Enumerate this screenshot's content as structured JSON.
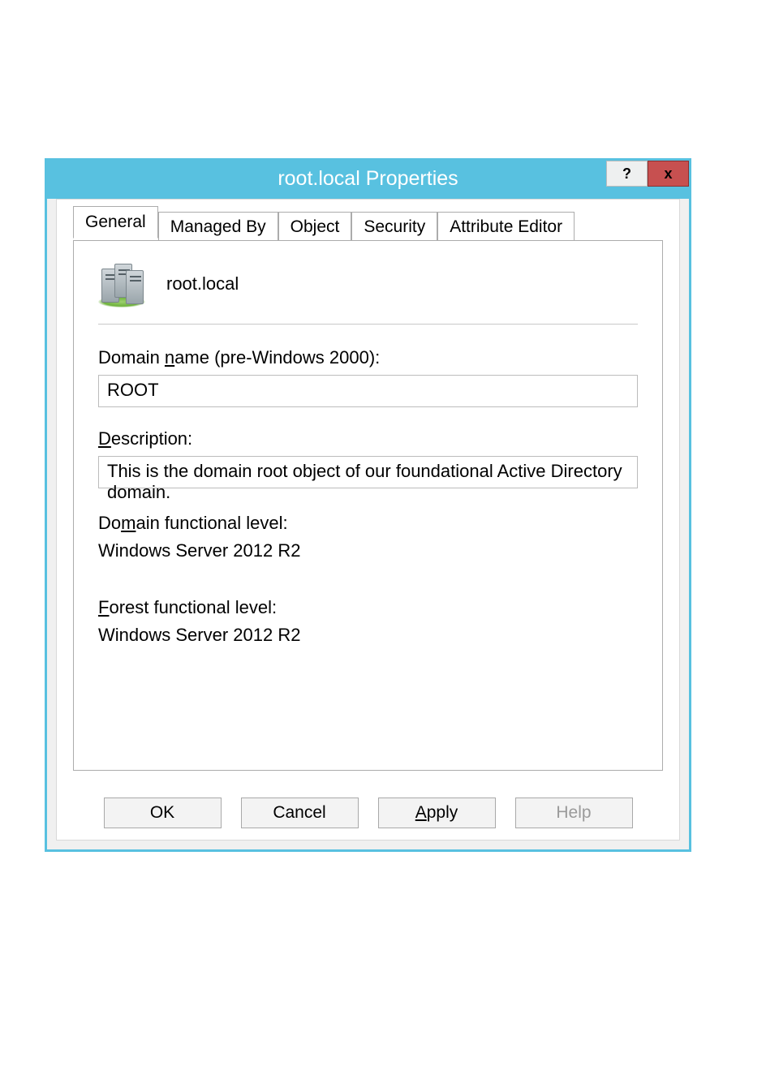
{
  "window": {
    "title": "root.local Properties"
  },
  "titlebar_buttons": {
    "help": "?",
    "close": "x"
  },
  "tabs": [
    "General",
    "Managed By",
    "Object",
    "Security",
    "Attribute Editor"
  ],
  "active_tab_index": 0,
  "general": {
    "domain_display_name": "root.local",
    "pre2000_label": "Domain name (pre-Windows 2000):",
    "pre2000_value": "ROOT",
    "description_label": "Description:",
    "description_value": "This is the domain root object of our foundational Active Directory domain.",
    "domain_func_label": "Domain functional level:",
    "domain_func_value": "Windows Server 2012 R2",
    "forest_func_label": "Forest functional level:",
    "forest_func_value": "Windows Server 2012 R2"
  },
  "buttons": {
    "ok": "OK",
    "cancel": "Cancel",
    "apply": "Apply",
    "help": "Help"
  }
}
